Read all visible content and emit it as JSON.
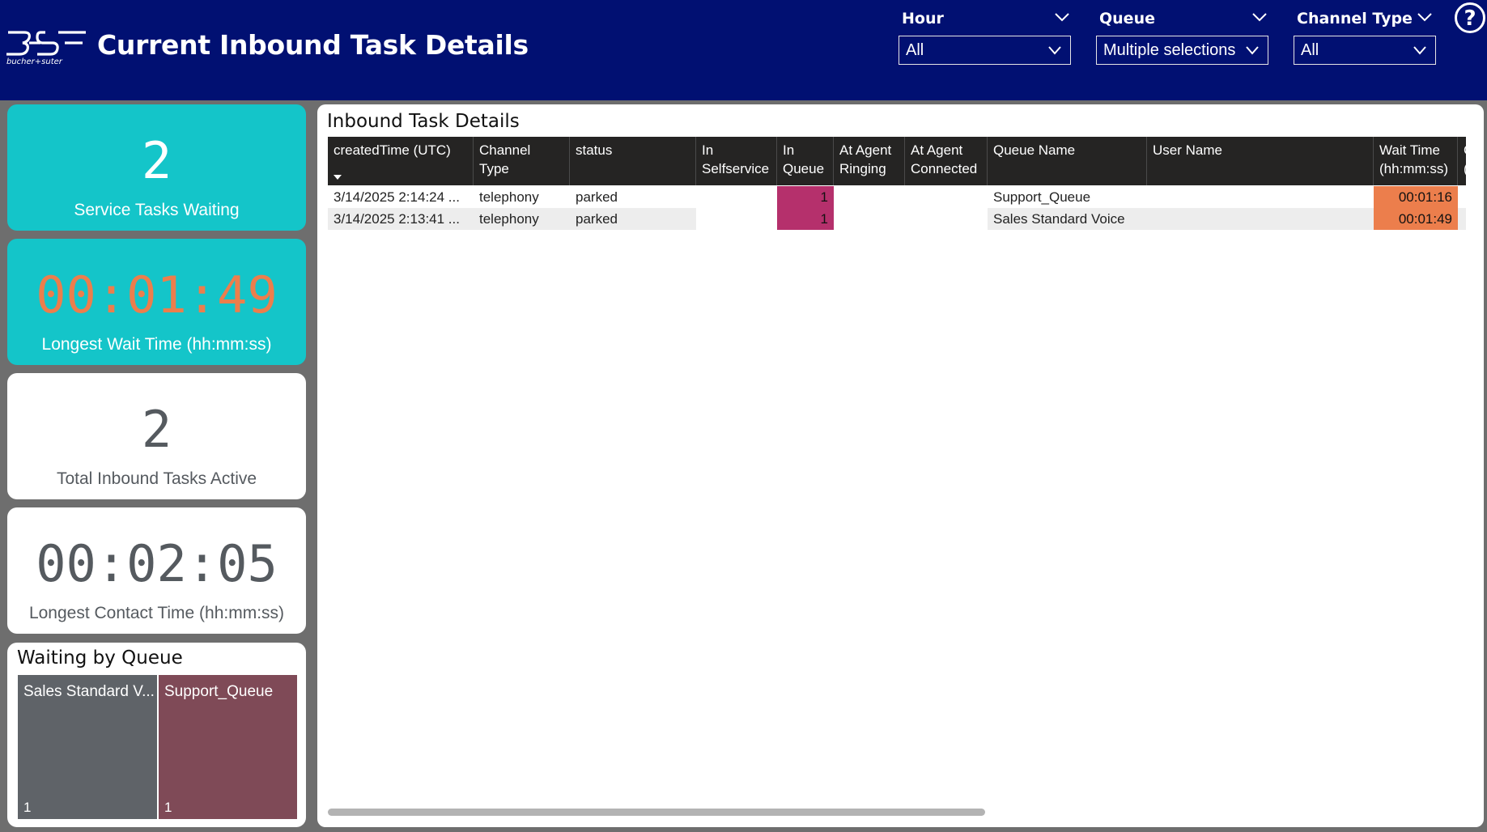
{
  "header": {
    "logo_text": "bucher+suter",
    "title": "Current Inbound Task Details",
    "help_icon": "question-circle-icon"
  },
  "slicers": [
    {
      "label": "Hour",
      "value": "All"
    },
    {
      "label": "Queue",
      "value": "Multiple selections"
    },
    {
      "label": "Channel Type",
      "value": "All"
    }
  ],
  "cards": [
    {
      "value": "2",
      "label": "Service Tasks Waiting"
    },
    {
      "value": "00:01:49",
      "label": "Longest Wait Time (hh:mm:ss)"
    },
    {
      "value": "2",
      "label": "Total Inbound Tasks Active"
    },
    {
      "value": "00:02:05",
      "label": "Longest Contact Time (hh:mm:ss)"
    }
  ],
  "waiting_by_queue": {
    "title": "Waiting by Queue",
    "tiles": [
      {
        "label": "Sales Standard V...",
        "count": "1"
      },
      {
        "label": "Support_Queue",
        "count": "1"
      }
    ]
  },
  "table": {
    "title": "Inbound Task Details",
    "columns": [
      {
        "line1": "createdTime (UTC)",
        "line2": ""
      },
      {
        "line1": "Channel Type",
        "line2": ""
      },
      {
        "line1": "status",
        "line2": ""
      },
      {
        "line1": "In",
        "line2": "Selfservice"
      },
      {
        "line1": "In",
        "line2": "Queue"
      },
      {
        "line1": "At Agent",
        "line2": "Ringing"
      },
      {
        "line1": "At Agent",
        "line2": "Connected"
      },
      {
        "line1": "Queue Name",
        "line2": ""
      },
      {
        "line1": "User Name",
        "line2": ""
      },
      {
        "line1": "Wait Time",
        "line2": "(hh:mm:ss)"
      },
      {
        "line1": "Co",
        "line2": "(h"
      }
    ],
    "rows": [
      {
        "created": "3/14/2025 2:14:24 ...",
        "channel": "telephony",
        "status": "parked",
        "selfservice": "",
        "in_queue": "1",
        "ringing": "",
        "connected": "",
        "queue": "Support_Queue",
        "user": "",
        "wait": "00:01:16"
      },
      {
        "created": "3/14/2025 2:13:41 ...",
        "channel": "telephony",
        "status": "parked",
        "selfservice": "",
        "in_queue": "1",
        "ringing": "",
        "connected": "",
        "queue": "Sales Standard Voice",
        "user": "",
        "wait": "00:01:49"
      }
    ]
  },
  "colors": {
    "header_bg": "#011072",
    "teal": "#14c5c9",
    "orange": "#ec7e4c",
    "magenta": "#b5306c",
    "tile_gray": "#5f6368",
    "tile_maroon": "#7f4a57"
  }
}
